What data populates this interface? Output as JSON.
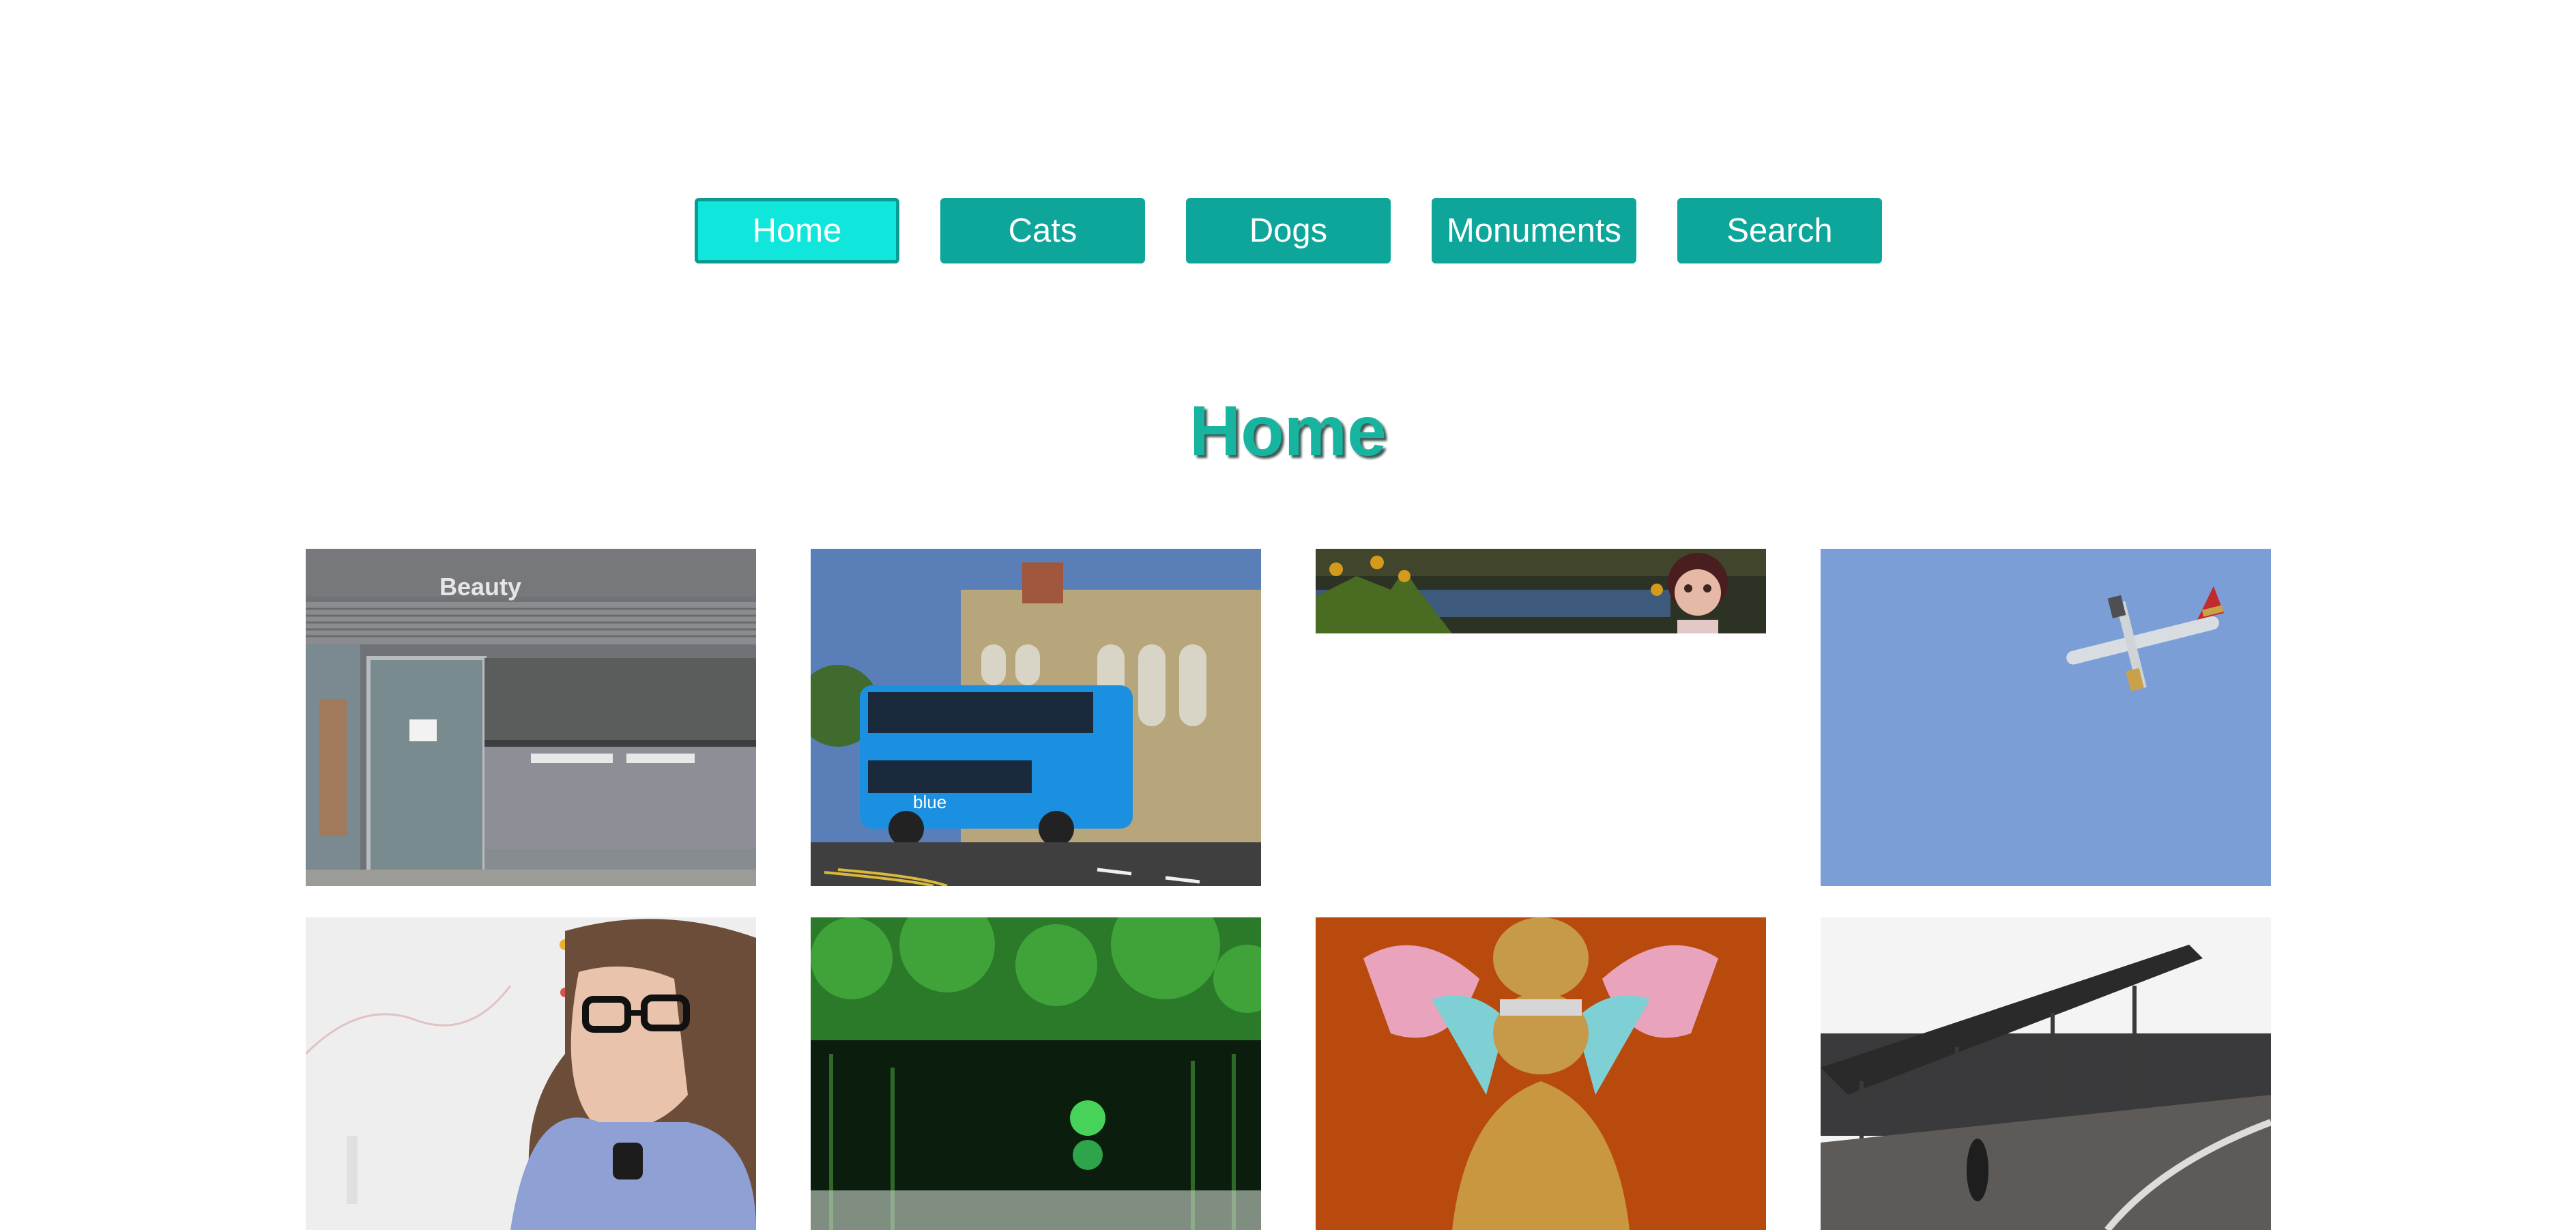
{
  "nav": {
    "items": [
      {
        "label": "Home",
        "active": true
      },
      {
        "label": "Cats",
        "active": false
      },
      {
        "label": "Dogs",
        "active": false
      },
      {
        "label": "Monuments",
        "active": false
      },
      {
        "label": "Search",
        "active": false
      }
    ]
  },
  "page": {
    "title": "Home"
  },
  "gallery": {
    "storefront": {
      "sign_text": "Beauty"
    },
    "bus": {
      "brand_text": "blue"
    }
  },
  "colors": {
    "button": "#0ea59a",
    "button_active": "#10e6dc",
    "title": "#17b59f"
  }
}
